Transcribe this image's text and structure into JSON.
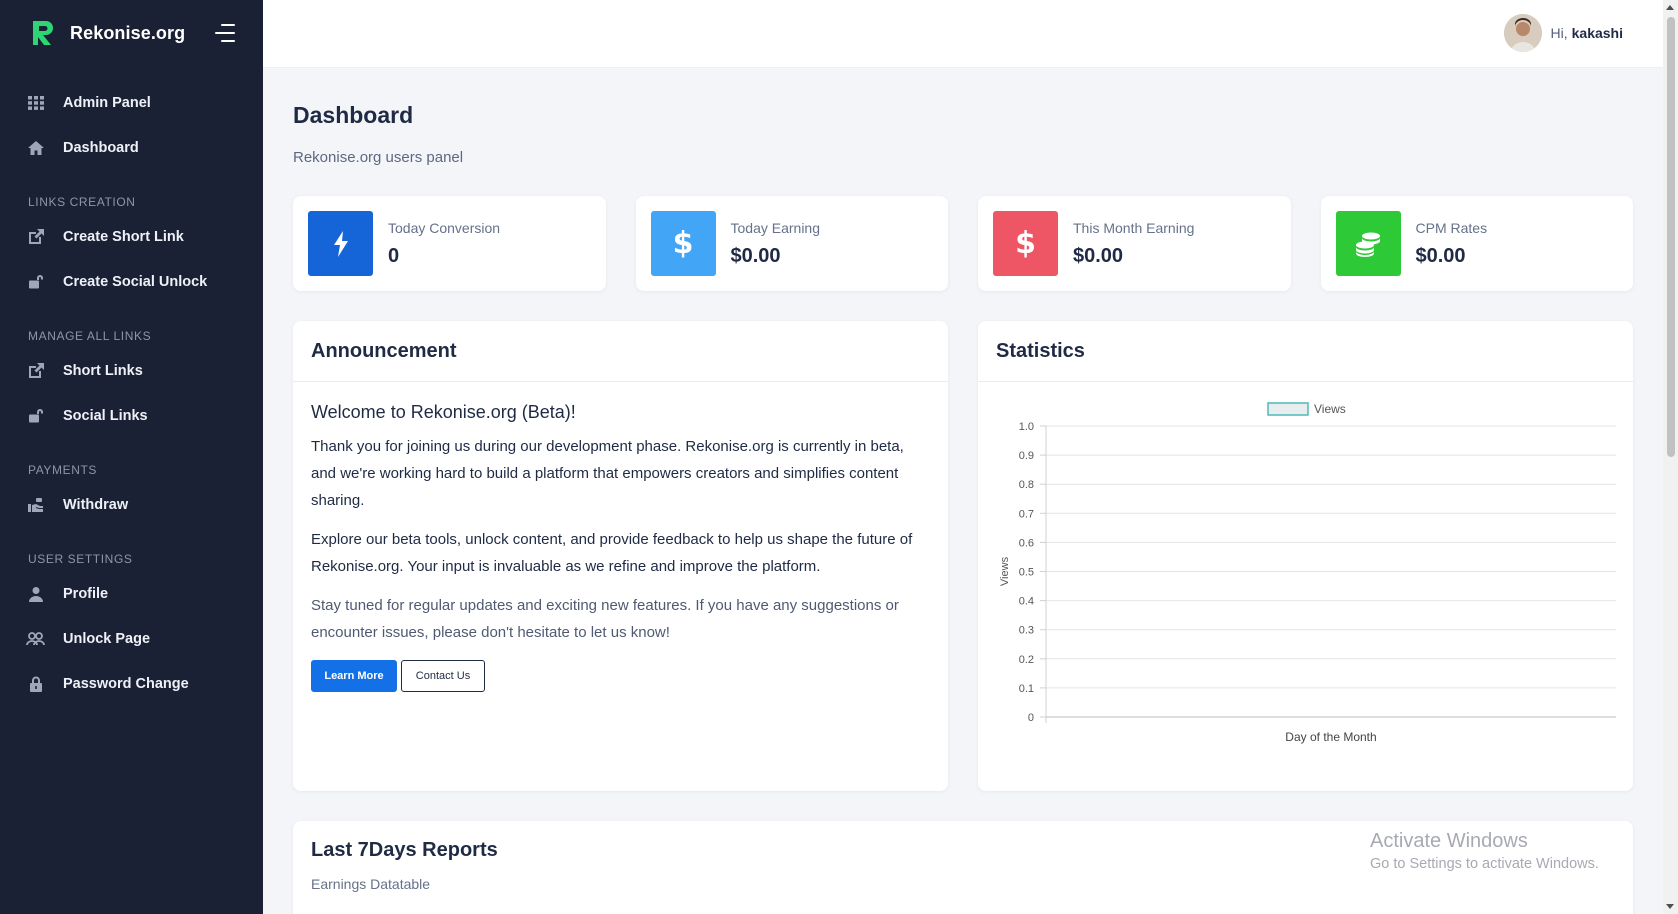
{
  "brand": {
    "name": "Rekonise.org"
  },
  "sidebar": {
    "items": [
      {
        "label": "Admin Panel",
        "icon": "grid-icon"
      },
      {
        "label": "Dashboard",
        "icon": "home-icon"
      }
    ],
    "sections": [
      {
        "heading": "LINKS CREATION",
        "items": [
          {
            "label": "Create Short Link",
            "icon": "external-link-icon"
          },
          {
            "label": "Create Social Unlock",
            "icon": "unlock-icon"
          }
        ]
      },
      {
        "heading": "MANAGE ALL LINKS",
        "items": [
          {
            "label": "Short Links",
            "icon": "external-link-icon"
          },
          {
            "label": "Social Links",
            "icon": "unlock-icon"
          }
        ]
      },
      {
        "heading": "PAYMENTS",
        "items": [
          {
            "label": "Withdraw",
            "icon": "hand-money-icon"
          }
        ]
      },
      {
        "heading": "USER SETTINGS",
        "items": [
          {
            "label": "Profile",
            "icon": "user-icon"
          },
          {
            "label": "Unlock Page",
            "icon": "users-unlock-icon"
          },
          {
            "label": "Password Change",
            "icon": "lock-icon"
          }
        ]
      }
    ]
  },
  "topbar": {
    "greeting": "Hi,",
    "username": "kakashi"
  },
  "page": {
    "title": "Dashboard",
    "subtitle": "Rekonise.org users panel"
  },
  "stats": [
    {
      "label": "Today Conversion",
      "value": "0",
      "color": "#1565d8",
      "icon": "bolt-icon"
    },
    {
      "label": "Today Earning",
      "value": "$0.00",
      "color": "#42a5f5",
      "icon": "dollar-icon"
    },
    {
      "label": "This Month Earning",
      "value": "$0.00",
      "color": "#ef5665",
      "icon": "dollar-icon"
    },
    {
      "label": "CPM Rates",
      "value": "$0.00",
      "color": "#2dc937",
      "icon": "coins-icon"
    }
  ],
  "announcement": {
    "heading": "Announcement",
    "title": "Welcome to Rekonise.org (Beta)!",
    "p1": "Thank you for joining us during our development phase. Rekonise.org is currently in beta, and we're working hard to build a platform that empowers creators and simplifies content sharing.",
    "p2": "Explore our beta tools, unlock content, and provide feedback to help us shape the future of Rekonise.org. Your input is invaluable as we refine and improve the platform.",
    "p3": "Stay tuned for regular updates and exciting new features. If you have any suggestions or encounter issues, please don't hesitate to let us know!",
    "learn_more": "Learn More",
    "contact_us": "Contact Us"
  },
  "statistics": {
    "heading": "Statistics"
  },
  "chart_data": {
    "type": "line",
    "x": [],
    "series": [
      {
        "name": "Views",
        "values": []
      }
    ],
    "xlabel": "Day of the Month",
    "ylabel": "Views",
    "ylim": [
      0,
      1
    ],
    "yticks": [
      "0",
      "0.1",
      "0.2",
      "0.3",
      "0.4",
      "0.5",
      "0.6",
      "0.7",
      "0.8",
      "0.9",
      "1.0"
    ],
    "grid": true,
    "legend": "top-center",
    "legend_fill": "#e8eeee",
    "legend_stroke": "#4fb8b8"
  },
  "reports": {
    "title": "Last 7Days Reports",
    "subtitle": "Earnings Datatable"
  },
  "watermark": {
    "line1": "Activate Windows",
    "line2": "Go to Settings to activate Windows."
  }
}
